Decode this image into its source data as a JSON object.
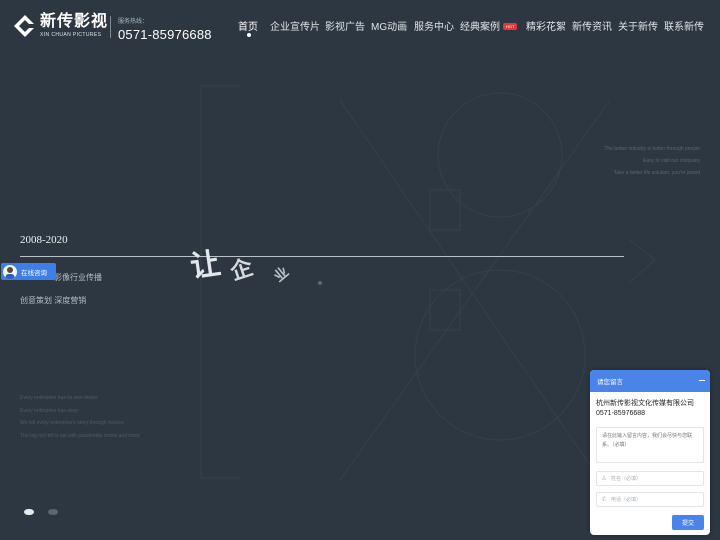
{
  "header": {
    "logo_cn": "新传影视",
    "logo_en": "XIN CHUAN PICTURES",
    "hotline_label": "服务热线：",
    "hotline_number": "0571-85976688",
    "nav": [
      {
        "label": "首页",
        "active": true
      },
      {
        "label": "企业宣传片"
      },
      {
        "label": "影视广告"
      },
      {
        "label": "MG动画"
      },
      {
        "label": "服务中心"
      },
      {
        "label": "经典案例",
        "badge": "HOT"
      },
      {
        "label": "精彩花絮"
      },
      {
        "label": "新传资讯"
      },
      {
        "label": "关于新传"
      },
      {
        "label": "联系新传"
      }
    ]
  },
  "hero": {
    "years": "2008-2020",
    "float_chars": [
      "让",
      "企",
      "业"
    ],
    "slogan_line1": "影像行业传播",
    "slogan_line2": "创意策划 深度营销",
    "en_right": [
      "The better industry is better through people",
      "Easy to visit our company",
      "Take a better life solution, you're joined"
    ],
    "en_left": [
      "Every enterprise has its own desire",
      "Every enterprise has story",
      "We tell every enterprise's story through movies",
      "The big rich bill is set with passionate movie and more"
    ]
  },
  "consult": {
    "label": "在线咨询"
  },
  "chat": {
    "title": "请您留言",
    "company": "杭州新传影视文化传媒有限公司",
    "phone": "0571-85976688",
    "message_placeholder": "请在此输入留言内容，我们会尽快与您联系。（必填）",
    "name_placeholder": "姓名（必填）",
    "phone_placeholder": "电话（必填）",
    "submit_label": "提交"
  },
  "colors": {
    "background": "#2c3741",
    "accent_blue": "#4a84e8",
    "hot_red": "#e0373f"
  },
  "icons": {
    "logo": "xc-logo-icon",
    "user": "user-icon",
    "phone": "phone-icon",
    "minimize": "minimize-icon"
  }
}
